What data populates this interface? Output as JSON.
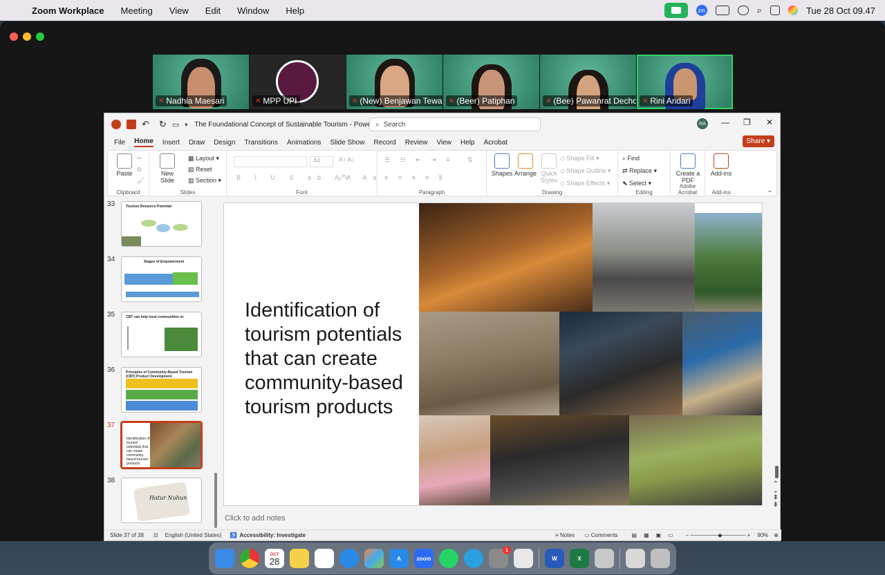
{
  "menubar": {
    "app_name": "Zoom Workplace",
    "items": [
      "Meeting",
      "View",
      "Edit",
      "Window",
      "Help"
    ],
    "datetime": "Tue 28 Oct 09.47"
  },
  "participants": [
    {
      "name": "Nadhia Maesari",
      "muted": true
    },
    {
      "name": "MPP UPI",
      "muted": true
    },
    {
      "name": "(New) Benjawan Tewa",
      "muted": true
    },
    {
      "name": "(Beer) Patiphan",
      "muted": true
    },
    {
      "name": "(Bee) Pawanrat Decho...",
      "muted": true
    },
    {
      "name": "Rini Andari",
      "muted": true,
      "active_speaker": true
    }
  ],
  "ppt": {
    "window_title": "The Foundational Concept of Sustainable Tourism  -  PowerP...",
    "search_placeholder": "Search",
    "user_initials": "RA",
    "tabs": [
      "File",
      "Home",
      "Insert",
      "Draw",
      "Design",
      "Transitions",
      "Animations",
      "Slide Show",
      "Record",
      "Review",
      "View",
      "Help",
      "Acrobat"
    ],
    "active_tab": "Home",
    "share_label": "Share",
    "ribbon": {
      "clipboard": {
        "label": "Clipboard",
        "paste": "Paste"
      },
      "slides": {
        "label": "Slides",
        "new_slide": "New Slide",
        "layout": "Layout",
        "reset": "Reset",
        "section": "Section"
      },
      "font": {
        "label": "Font",
        "size": "44"
      },
      "paragraph": {
        "label": "Paragraph"
      },
      "drawing": {
        "label": "Drawing",
        "shapes": "Shapes",
        "arrange": "Arrange",
        "quick_styles": "Quick Styles",
        "shape_fill": "Shape Fill",
        "shape_outline": "Shape Outline",
        "shape_effects": "Shape Effects"
      },
      "editing": {
        "label": "Editing",
        "find": "Find",
        "replace": "Replace",
        "select": "Select"
      },
      "acrobat": {
        "label": "Adobe Acrobat",
        "create_pdf": "Create a PDF"
      },
      "addins": {
        "label": "Add-ins",
        "button": "Add-ins"
      }
    },
    "thumbnails": [
      {
        "num": "33",
        "title": "Tourism Resource Potential"
      },
      {
        "num": "34",
        "title": "Stages of Empowerment"
      },
      {
        "num": "35",
        "title": "CBT can help local communities in:"
      },
      {
        "num": "36",
        "title": "Principles of Community-Based Tourism (CBT) Product Development"
      },
      {
        "num": "37",
        "title": "Identification of tourism potentials that can create community-based tourism products",
        "selected": true
      },
      {
        "num": "38",
        "title": "Hatur Nuhun"
      }
    ],
    "slide": {
      "heading": "Identification of tourism potentials that can create community-based tourism products"
    },
    "notes_placeholder": "Click to add notes",
    "status": {
      "slide_of": "Slide 37 of 38",
      "language": "English (United States)",
      "accessibility": "Accessibility: Investigate",
      "notes": "Notes",
      "comments": "Comments",
      "zoom": "90%"
    }
  },
  "dock": {
    "calendar_month": "OCT",
    "calendar_day": "28",
    "zoom_label": "zoom",
    "badge": "1"
  }
}
